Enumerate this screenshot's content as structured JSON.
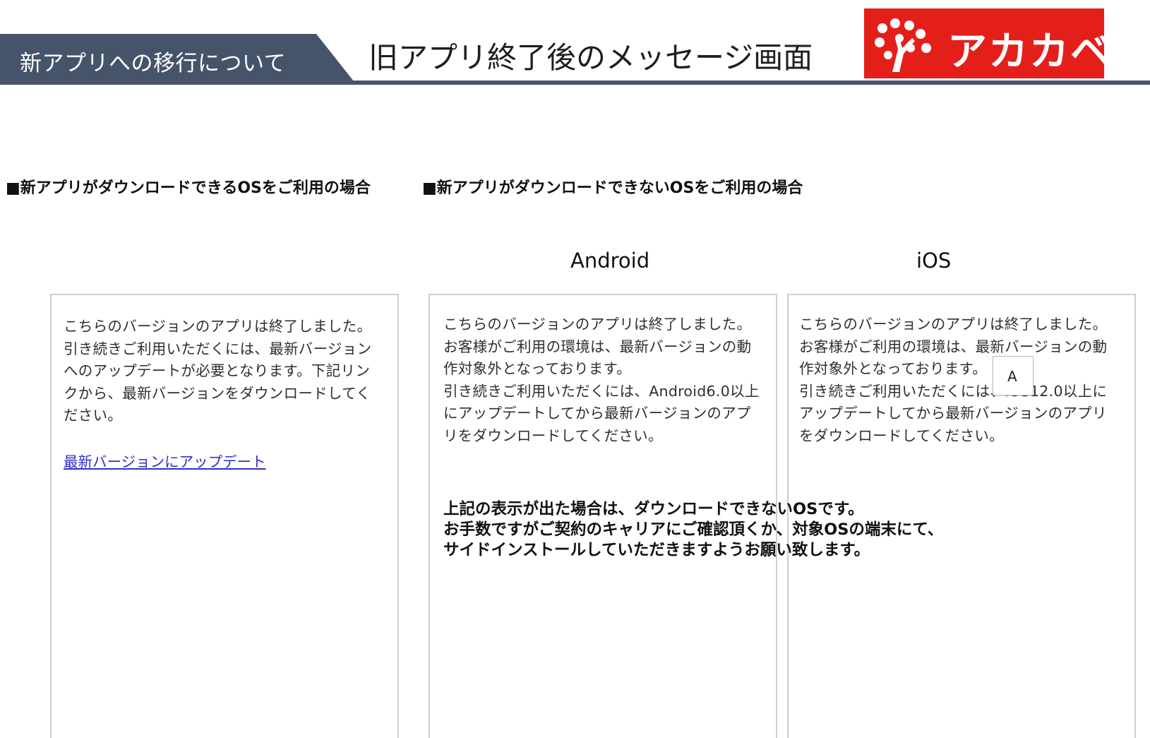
{
  "header": {
    "banner_label": "新アプリへの移行について",
    "title": "旧アプリ終了後のメッセージ画面"
  },
  "logo": {
    "text": "アカカベ",
    "background_color": "#e41f1a"
  },
  "colors": {
    "banner": "#46546b",
    "link": "#2f2fc8"
  },
  "sections": {
    "supported": "■新アプリがダウンロードできるOSをご利用の場合",
    "unsupported": "■新アプリがダウンロードできないOSをご利用の場合"
  },
  "platforms": {
    "android": "Android",
    "ios": "iOS"
  },
  "screens": {
    "supported": {
      "lines": [
        "こちらのバージョンのアプリは終了しました。",
        "引き続きご利用いただくには、最新バージョン",
        "へのアップデートが必要となります。下記リン",
        "クから、最新バージョンをダウンロードしてく",
        "ださい。"
      ],
      "link_label": "最新バージョンにアップデート"
    },
    "android": {
      "lines": [
        "こちらのバージョンのアプリは終了しました。",
        "お客様がご利用の環境は、最新バージョンの動",
        "作対象外となっております。",
        "引き続きご利用いただくには、Android6.0以上",
        "にアップデートしてから最新バージョンのアプ",
        "リをダウンロードしてください。"
      ]
    },
    "ios": {
      "lines": [
        "こちらのバージョンのアプリは終了しました。",
        "お客様がご利用の環境は、最新バージョンの動",
        "作対象外となっております。",
        "引き続きご利用いただくには、iOS12.0以上に",
        "アップデートしてから最新バージョンのアプリ",
        "をダウンロードしてください。"
      ]
    }
  },
  "tooltip": {
    "label": "A"
  },
  "note": {
    "lines": [
      "上記の表示が出た場合は、ダウンロードできないOSです。",
      "お手数ですがご契約のキャリアにご確認頂くか、対象OSの端末にて、",
      "サイドインストールしていただきますようお願い致します。"
    ]
  }
}
